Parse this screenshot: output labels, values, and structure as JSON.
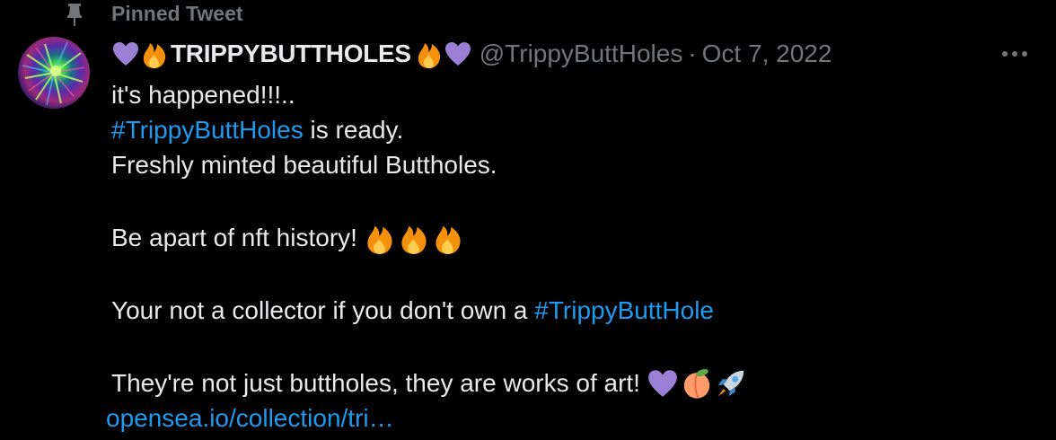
{
  "pinned": {
    "label": "Pinned Tweet",
    "icon": "pin-icon"
  },
  "tweet": {
    "author": {
      "display_name": "TRIPPYBUTTHOLES",
      "name_prefix_emojis": [
        "purple-heart-icon",
        "fire-icon"
      ],
      "name_suffix_emojis": [
        "fire-icon",
        "purple-heart-icon"
      ],
      "handle": "@TrippyButtHoles",
      "avatar": "avatar"
    },
    "separator": "·",
    "date": "Oct 7, 2022",
    "more_icon": "more-dots-icon",
    "lines": {
      "l1": "it's happened!!!..",
      "l2_hashtag": "#TrippyButtHoles",
      "l2_text": " is ready.",
      "l3": "Freshly minted beautiful Buttholes.",
      "l4": "Be apart of nft history!",
      "l5_text": "Your not a collector if you don't own a ",
      "l5_hashtag": "#TrippyButtHole",
      "l6": "They're not just buttholes, they are works of art!",
      "link": "opensea.io/collection/tri…"
    },
    "inline_emojis": {
      "l4": [
        "fire-icon",
        "fire-icon",
        "fire-icon"
      ],
      "l6": [
        "purple-heart-icon",
        "peach-icon",
        "rocket-icon"
      ]
    }
  },
  "colors": {
    "background": "#000000",
    "text": "#e7e9ea",
    "secondary": "#71767b",
    "link": "#1d9bf0",
    "purple_heart": "#9b7fd4",
    "fire": "#f4900c"
  }
}
